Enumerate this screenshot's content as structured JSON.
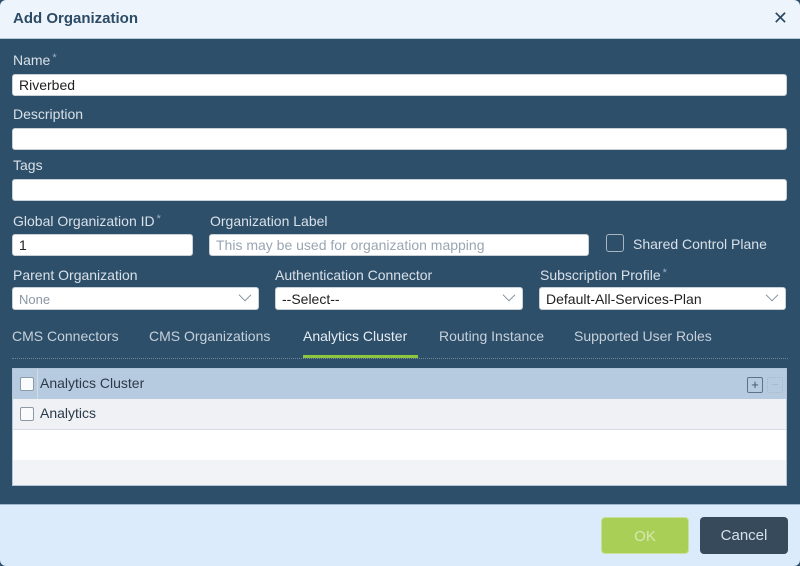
{
  "dialog": {
    "title": "Add Organization",
    "close_icon": "close-icon"
  },
  "form": {
    "name": {
      "label": "Name",
      "required_mark": "*",
      "value": "Riverbed"
    },
    "description": {
      "label": "Description",
      "value": ""
    },
    "tags": {
      "label": "Tags",
      "value": ""
    },
    "global_org_id": {
      "label": "Global Organization ID",
      "required_mark": "*",
      "value": "1"
    },
    "org_label": {
      "label": "Organization Label",
      "value": "",
      "placeholder": "This may be used for organization mapping"
    },
    "shared_control_plane": {
      "label": "Shared Control Plane",
      "checked": false
    },
    "parent_org": {
      "label": "Parent Organization",
      "value": "None"
    },
    "auth_connector": {
      "label": "Authentication Connector",
      "value": "--Select--"
    },
    "subscription_profile": {
      "label": "Subscription Profile",
      "required_mark": "*",
      "value": "Default-All-Services-Plan"
    }
  },
  "tabs": [
    {
      "label": "CMS Connectors",
      "active": false
    },
    {
      "label": "CMS Organizations",
      "active": false
    },
    {
      "label": "Analytics Cluster",
      "active": true
    },
    {
      "label": "Routing Instance",
      "active": false
    },
    {
      "label": "Supported User Roles",
      "active": false
    }
  ],
  "grid": {
    "header": "Analytics Cluster",
    "add_icon": "plus-icon",
    "remove_icon": "minus-icon",
    "add_symbol": "+",
    "remove_symbol": "−",
    "rows": [
      {
        "value": "Analytics"
      }
    ]
  },
  "footer": {
    "ok_label": "OK",
    "cancel_label": "Cancel"
  },
  "colors": {
    "body_bg": "#2e4f6a",
    "accent_green": "#8cc63f",
    "ok_button": "#a9cf57",
    "cancel_button": "#364a5c"
  }
}
